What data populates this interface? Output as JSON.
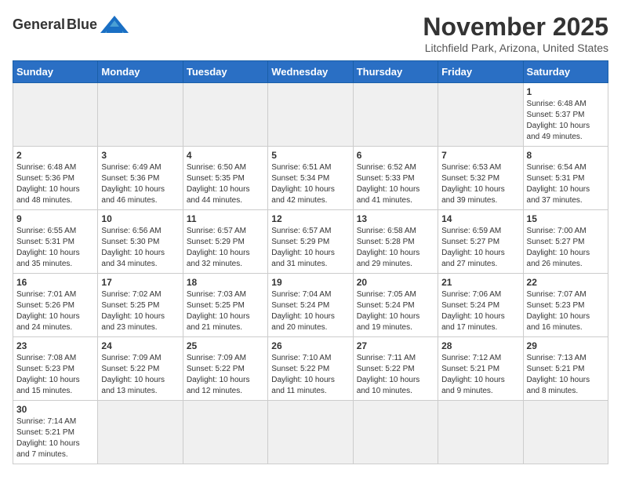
{
  "header": {
    "logo_general": "General",
    "logo_blue": "Blue",
    "month": "November 2025",
    "location": "Litchfield Park, Arizona, United States"
  },
  "days_of_week": [
    "Sunday",
    "Monday",
    "Tuesday",
    "Wednesday",
    "Thursday",
    "Friday",
    "Saturday"
  ],
  "weeks": [
    [
      null,
      null,
      null,
      null,
      null,
      null,
      {
        "day": "1",
        "sunrise": "Sunrise: 6:48 AM",
        "sunset": "Sunset: 5:37 PM",
        "daylight": "Daylight: 10 hours and 49 minutes."
      }
    ],
    [
      {
        "day": "2",
        "sunrise": "Sunrise: 6:48 AM",
        "sunset": "Sunset: 5:36 PM",
        "daylight": "Daylight: 10 hours and 48 minutes."
      },
      {
        "day": "3",
        "sunrise": "Sunrise: 6:49 AM",
        "sunset": "Sunset: 5:36 PM",
        "daylight": "Daylight: 10 hours and 46 minutes."
      },
      {
        "day": "4",
        "sunrise": "Sunrise: 6:50 AM",
        "sunset": "Sunset: 5:35 PM",
        "daylight": "Daylight: 10 hours and 44 minutes."
      },
      {
        "day": "5",
        "sunrise": "Sunrise: 6:51 AM",
        "sunset": "Sunset: 5:34 PM",
        "daylight": "Daylight: 10 hours and 42 minutes."
      },
      {
        "day": "6",
        "sunrise": "Sunrise: 6:52 AM",
        "sunset": "Sunset: 5:33 PM",
        "daylight": "Daylight: 10 hours and 41 minutes."
      },
      {
        "day": "7",
        "sunrise": "Sunrise: 6:53 AM",
        "sunset": "Sunset: 5:32 PM",
        "daylight": "Daylight: 10 hours and 39 minutes."
      },
      {
        "day": "8",
        "sunrise": "Sunrise: 6:54 AM",
        "sunset": "Sunset: 5:31 PM",
        "daylight": "Daylight: 10 hours and 37 minutes."
      }
    ],
    [
      {
        "day": "9",
        "sunrise": "Sunrise: 6:55 AM",
        "sunset": "Sunset: 5:31 PM",
        "daylight": "Daylight: 10 hours and 35 minutes."
      },
      {
        "day": "10",
        "sunrise": "Sunrise: 6:56 AM",
        "sunset": "Sunset: 5:30 PM",
        "daylight": "Daylight: 10 hours and 34 minutes."
      },
      {
        "day": "11",
        "sunrise": "Sunrise: 6:57 AM",
        "sunset": "Sunset: 5:29 PM",
        "daylight": "Daylight: 10 hours and 32 minutes."
      },
      {
        "day": "12",
        "sunrise": "Sunrise: 6:57 AM",
        "sunset": "Sunset: 5:29 PM",
        "daylight": "Daylight: 10 hours and 31 minutes."
      },
      {
        "day": "13",
        "sunrise": "Sunrise: 6:58 AM",
        "sunset": "Sunset: 5:28 PM",
        "daylight": "Daylight: 10 hours and 29 minutes."
      },
      {
        "day": "14",
        "sunrise": "Sunrise: 6:59 AM",
        "sunset": "Sunset: 5:27 PM",
        "daylight": "Daylight: 10 hours and 27 minutes."
      },
      {
        "day": "15",
        "sunrise": "Sunrise: 7:00 AM",
        "sunset": "Sunset: 5:27 PM",
        "daylight": "Daylight: 10 hours and 26 minutes."
      }
    ],
    [
      {
        "day": "16",
        "sunrise": "Sunrise: 7:01 AM",
        "sunset": "Sunset: 5:26 PM",
        "daylight": "Daylight: 10 hours and 24 minutes."
      },
      {
        "day": "17",
        "sunrise": "Sunrise: 7:02 AM",
        "sunset": "Sunset: 5:25 PM",
        "daylight": "Daylight: 10 hours and 23 minutes."
      },
      {
        "day": "18",
        "sunrise": "Sunrise: 7:03 AM",
        "sunset": "Sunset: 5:25 PM",
        "daylight": "Daylight: 10 hours and 21 minutes."
      },
      {
        "day": "19",
        "sunrise": "Sunrise: 7:04 AM",
        "sunset": "Sunset: 5:24 PM",
        "daylight": "Daylight: 10 hours and 20 minutes."
      },
      {
        "day": "20",
        "sunrise": "Sunrise: 7:05 AM",
        "sunset": "Sunset: 5:24 PM",
        "daylight": "Daylight: 10 hours and 19 minutes."
      },
      {
        "day": "21",
        "sunrise": "Sunrise: 7:06 AM",
        "sunset": "Sunset: 5:24 PM",
        "daylight": "Daylight: 10 hours and 17 minutes."
      },
      {
        "day": "22",
        "sunrise": "Sunrise: 7:07 AM",
        "sunset": "Sunset: 5:23 PM",
        "daylight": "Daylight: 10 hours and 16 minutes."
      }
    ],
    [
      {
        "day": "23",
        "sunrise": "Sunrise: 7:08 AM",
        "sunset": "Sunset: 5:23 PM",
        "daylight": "Daylight: 10 hours and 15 minutes."
      },
      {
        "day": "24",
        "sunrise": "Sunrise: 7:09 AM",
        "sunset": "Sunset: 5:22 PM",
        "daylight": "Daylight: 10 hours and 13 minutes."
      },
      {
        "day": "25",
        "sunrise": "Sunrise: 7:09 AM",
        "sunset": "Sunset: 5:22 PM",
        "daylight": "Daylight: 10 hours and 12 minutes."
      },
      {
        "day": "26",
        "sunrise": "Sunrise: 7:10 AM",
        "sunset": "Sunset: 5:22 PM",
        "daylight": "Daylight: 10 hours and 11 minutes."
      },
      {
        "day": "27",
        "sunrise": "Sunrise: 7:11 AM",
        "sunset": "Sunset: 5:22 PM",
        "daylight": "Daylight: 10 hours and 10 minutes."
      },
      {
        "day": "28",
        "sunrise": "Sunrise: 7:12 AM",
        "sunset": "Sunset: 5:21 PM",
        "daylight": "Daylight: 10 hours and 9 minutes."
      },
      {
        "day": "29",
        "sunrise": "Sunrise: 7:13 AM",
        "sunset": "Sunset: 5:21 PM",
        "daylight": "Daylight: 10 hours and 8 minutes."
      }
    ],
    [
      {
        "day": "30",
        "sunrise": "Sunrise: 7:14 AM",
        "sunset": "Sunset: 5:21 PM",
        "daylight": "Daylight: 10 hours and 7 minutes."
      },
      null,
      null,
      null,
      null,
      null,
      null
    ]
  ]
}
